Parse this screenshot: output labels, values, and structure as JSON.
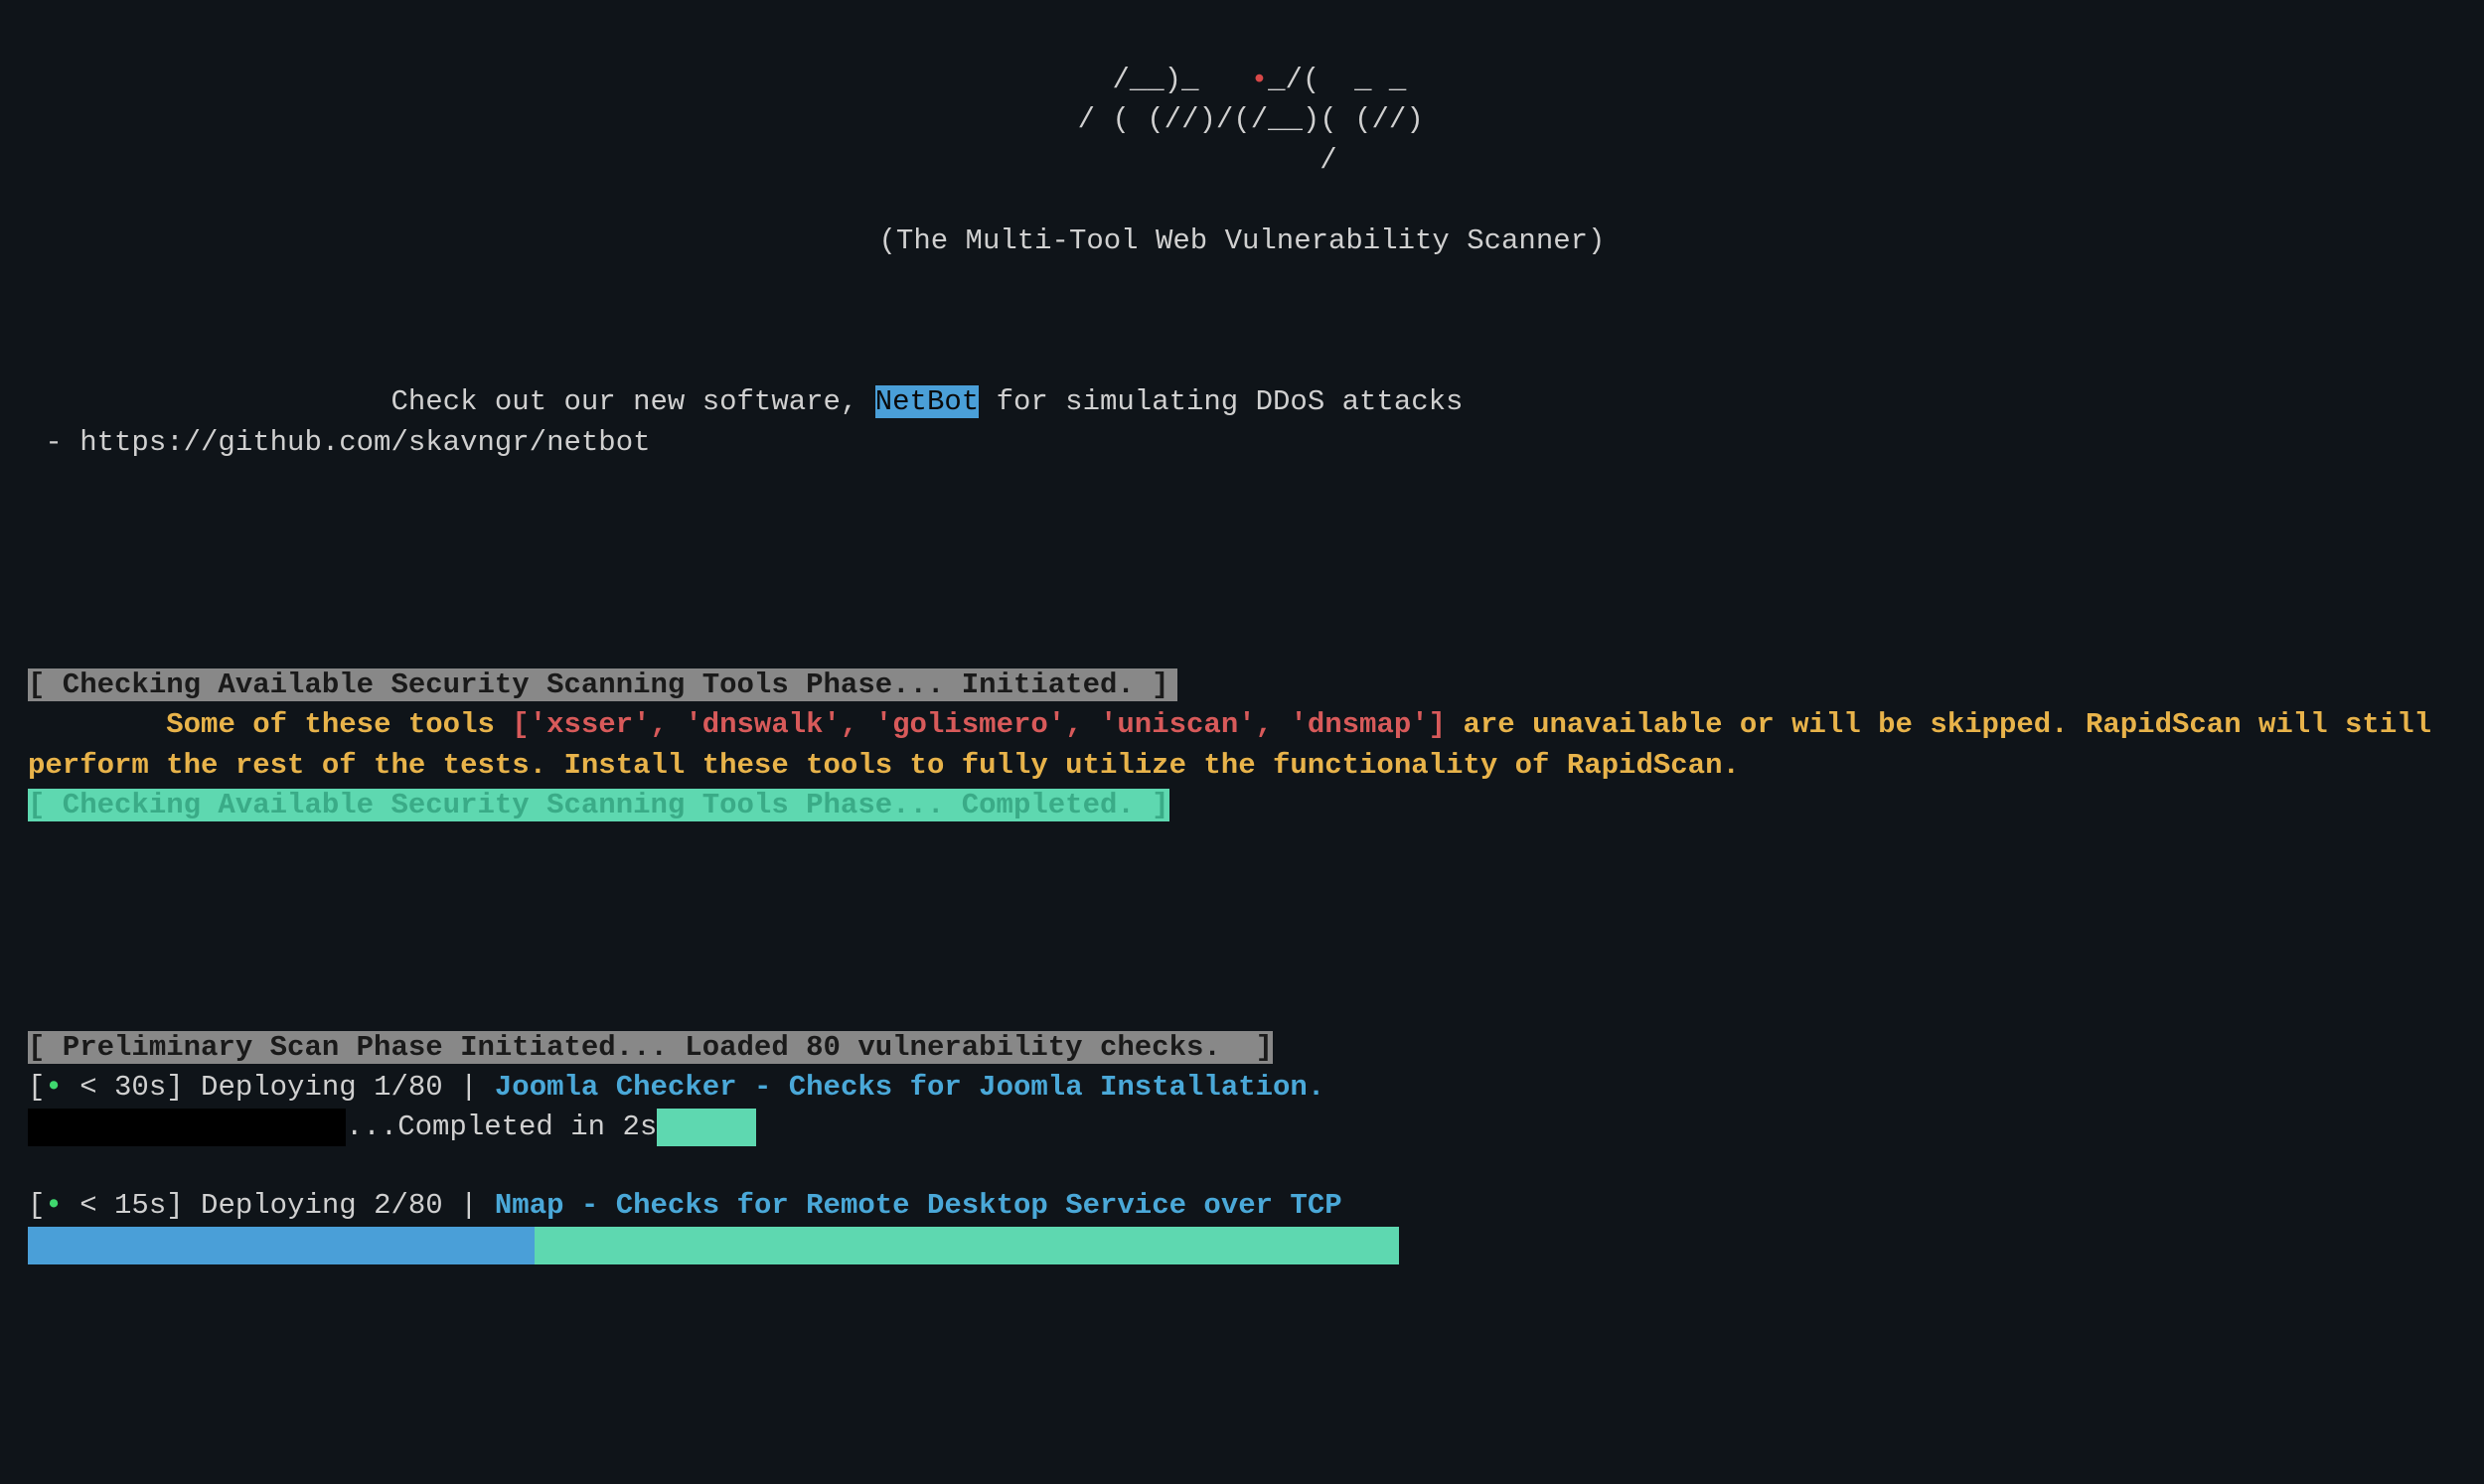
{
  "logo": {
    "line1": "  /__)_   ",
    "line1b": "_/(  _ _",
    "dot": "•",
    "line2": " / ( (//)/(/__)( (//)",
    "line3": "          /"
  },
  "tagline": "(The Multi-Tool Web Vulnerability Scanner)",
  "promo": {
    "prefix": "Check out our new software, ",
    "highlight": "NetBot",
    "suffix": " for simulating DDoS attacks",
    "url_line": " - https://github.com/skavngr/netbot"
  },
  "phase1": {
    "header": "[ Checking Available Security Scanning Tools Phase... Initiated. ]",
    "msg_prefix": "        Some of these tools ",
    "tools_list": "['xsser', 'dnswalk', 'golismero', 'uniscan', 'dnsmap']",
    "msg_suffix": " are unavailable or will be skipped. RapidScan will still perform the rest of the tests. Install these tools to fully utilize the functionality of RapidScan.",
    "footer": "[ Checking Available Security Scanning Tools Phase... Completed. ]"
  },
  "phase2": {
    "header": "[ Preliminary Scan Phase Initiated... Loaded 80 vulnerability checks.  ]",
    "check1": {
      "time": "< 30s",
      "deploy": "Deploying 1/80 | ",
      "desc": "Joomla Checker - Checks for Joomla Installation.",
      "completed": "...Completed in 2s"
    },
    "check2": {
      "time": "< 15s",
      "deploy": "Deploying 2/80 | ",
      "desc": "Nmap - Checks for Remote Desktop Service over TCP"
    }
  }
}
